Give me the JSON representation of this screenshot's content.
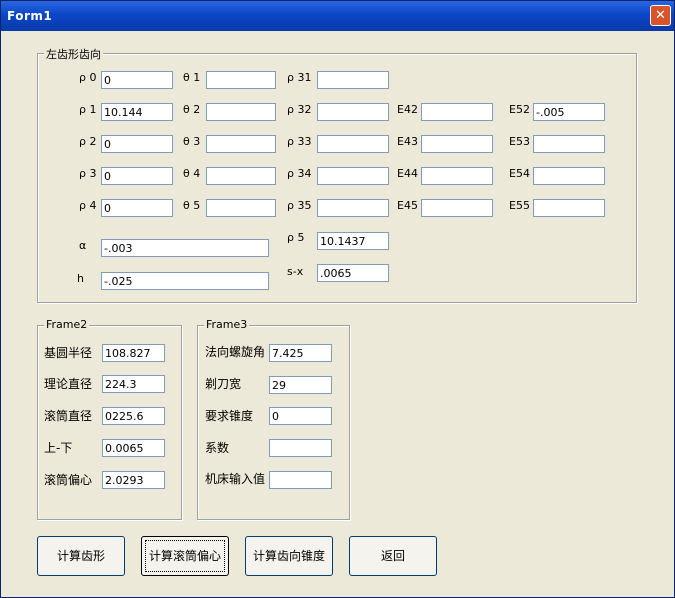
{
  "window": {
    "title": "Form1",
    "close_glyph": "✕"
  },
  "frame1": {
    "legend": "左齿形齿向",
    "rows": [
      [
        {
          "label": "ρ 0",
          "value": "0"
        },
        {
          "label": "θ 1",
          "value": ""
        },
        {
          "label": "ρ 31",
          "value": ""
        }
      ],
      [
        {
          "label": "ρ 1",
          "value": "10.144"
        },
        {
          "label": "θ 2",
          "value": ""
        },
        {
          "label": "ρ 32",
          "value": ""
        },
        {
          "label": "E42",
          "value": ""
        },
        {
          "label": "E52",
          "value": "-.005"
        }
      ],
      [
        {
          "label": "ρ 2",
          "value": "0"
        },
        {
          "label": "θ 3",
          "value": ""
        },
        {
          "label": "ρ 33",
          "value": ""
        },
        {
          "label": "E43",
          "value": ""
        },
        {
          "label": "E53",
          "value": ""
        }
      ],
      [
        {
          "label": "ρ 3",
          "value": "0"
        },
        {
          "label": "θ 4",
          "value": ""
        },
        {
          "label": "ρ 34",
          "value": ""
        },
        {
          "label": "E44",
          "value": ""
        },
        {
          "label": "E54",
          "value": ""
        }
      ],
      [
        {
          "label": "ρ 4",
          "value": "0"
        },
        {
          "label": "θ 5",
          "value": ""
        },
        {
          "label": "ρ 35",
          "value": ""
        },
        {
          "label": "E45",
          "value": ""
        },
        {
          "label": "E55",
          "value": ""
        }
      ]
    ],
    "alpha": {
      "label": "α",
      "value": "-.003"
    },
    "h": {
      "label": "h",
      "value": "-.025"
    },
    "rho5": {
      "label": "ρ 5",
      "value": "10.1437"
    },
    "sx": {
      "label": "s-x",
      "value": ".0065"
    }
  },
  "frame2": {
    "legend": "Frame2",
    "items": [
      {
        "label": "基圆半径",
        "value": "108.827"
      },
      {
        "label": "理论直径",
        "value": "224.3"
      },
      {
        "label": "滚筒直径",
        "value": "0225.6"
      },
      {
        "label": "上-下",
        "value": "0.0065"
      },
      {
        "label": "滚筒偏心",
        "value": "2.0293"
      }
    ]
  },
  "frame3": {
    "legend": "Frame3",
    "items": [
      {
        "label": "法向螺旋角",
        "value": "7.425"
      },
      {
        "label": "剃刀宽",
        "value": "29"
      },
      {
        "label": "要求锥度",
        "value": "0"
      },
      {
        "label": "系数",
        "value": ""
      },
      {
        "label": "机床输入值",
        "value": ""
      }
    ]
  },
  "buttons": [
    {
      "label": "计算齿形"
    },
    {
      "label": "计算滚筒偏心"
    },
    {
      "label": "计算齿向锥度"
    },
    {
      "label": "返回"
    }
  ]
}
